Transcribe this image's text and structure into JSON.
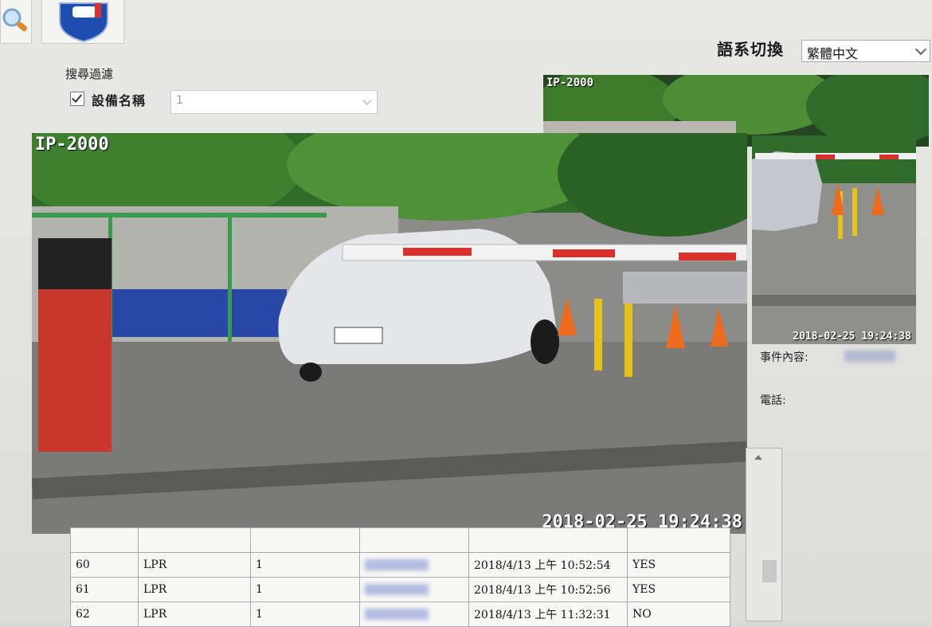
{
  "toolbar": {
    "icon_search": "search-icon",
    "icon_car_shield": "car-shield-icon"
  },
  "language": {
    "label": "語系切換",
    "selected": "繁體中文"
  },
  "filter": {
    "title": "搜尋過濾",
    "device_label": "設備名稱",
    "device_value": "1",
    "device_checked": true
  },
  "camera_main": {
    "tag": "IP-2000",
    "timestamp": "2018-02-25 19:24:38"
  },
  "camera_top": {
    "tag": "IP-2000"
  },
  "camera_side": {
    "timestamp": "2018-02-25 19:24:38"
  },
  "event": {
    "content_label": "事件內容:",
    "phone_label": "電話:"
  },
  "log": {
    "rows": [
      {
        "no": "60",
        "type": "LPR",
        "device": "1",
        "time": "2018/4/13 上午 10:52:54",
        "status": "YES"
      },
      {
        "no": "61",
        "type": "LPR",
        "device": "1",
        "time": "2018/4/13 上午 10:52:56",
        "status": "YES"
      },
      {
        "no": "62",
        "type": "LPR",
        "device": "1",
        "time": "2018/4/13 上午 11:32:31",
        "status": "NO"
      }
    ]
  },
  "colors": {
    "accent": "#2a63c9",
    "barrier_red": "#d9302a",
    "foliage": "#2f6b2a"
  }
}
